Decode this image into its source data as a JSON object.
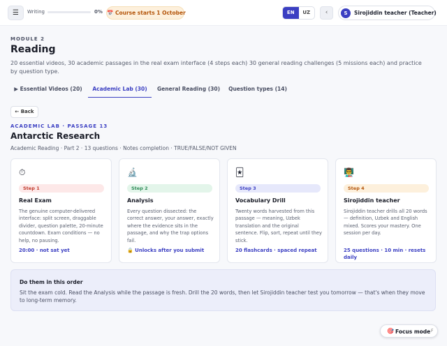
{
  "topbar": {
    "menu_icon": "menu-icon",
    "menu_glyph": "☰",
    "writing_label": "Writing",
    "progress_pct": "0%",
    "progress_fraction": 0,
    "course_notice": "📅 Course starts 1 October",
    "languages": [
      {
        "code": "EN",
        "active": true
      },
      {
        "code": "UZ",
        "active": false
      }
    ],
    "collapse_glyph": "‹",
    "user": {
      "initial": "S",
      "name": "Sirojiddin teacher (Teacher)"
    }
  },
  "module": {
    "label": "MODULE 2",
    "title": "Reading",
    "description": "20 essential videos, 30 academic passages in the real exam interface (4 steps each) 30 general reading challenges (5 missions each) and practice by question type."
  },
  "tabs": [
    {
      "label": "▶ Essential Videos (20)",
      "active": false
    },
    {
      "label": "Academic Lab (30)",
      "active": true
    },
    {
      "label": "General Reading (30)",
      "active": false
    },
    {
      "label": "Question types (14)",
      "active": false
    }
  ],
  "back_label": "← Back",
  "passage": {
    "label": "ACADEMIC LAB · PASSAGE 13",
    "title": "Antarctic Research",
    "meta": "Academic Reading · Part 2 · 13 questions · Notes completion · TRUE/FALSE/NOT GIVEN"
  },
  "cards": [
    {
      "icon": "stopwatch-icon",
      "glyph": "⏱",
      "step": "Step 1",
      "step_color": "#c0392b",
      "step_bg": "#fde8e8",
      "title": "Real Exam",
      "body": "The genuine computer-delivered interface: split screen, draggable divider, question palette, 20-minute countdown. Exam conditions — no help, no pausing.",
      "footer": "20:00 · not sat yet"
    },
    {
      "icon": "microscope-icon",
      "glyph": "🔬",
      "step": "Step 2",
      "step_color": "#2e8b57",
      "step_bg": "#e3f5ea",
      "title": "Analysis",
      "body": "Every question dissected: the correct answer, your answer, exactly where the evidence sits in the passage, and why the trap options fail.",
      "footer": "🔒 Unlocks after you submit"
    },
    {
      "icon": "flashcard-icon",
      "glyph": "🃏",
      "step": "Step 3",
      "step_color": "#3b3fc2",
      "step_bg": "#e6e8fb",
      "title": "Vocabulary Drill",
      "body": "Twenty words harvested from this passage — meaning, Uzbek translation and the original sentence. Flip, sort, repeat until they stick.",
      "footer": "20 flashcards · spaced repeat"
    },
    {
      "icon": "teacher-icon",
      "glyph": "👨‍🏫",
      "step": "Step 4",
      "step_color": "#b4560c",
      "step_bg": "#fdf0dc",
      "title": "Sirojiddin teacher",
      "body": "Sirojiddin teacher drills all 20 words — definition, Uzbek and English mixed. Scores your mastery. One session per day.",
      "footer": "25 questions · 10 min · resets daily"
    }
  ],
  "order": {
    "title": "Do them in this order",
    "body": "Sit the exam cold. Read the Analysis while the passage is fresh. Drill the 20 words, then let Sirojiddin teacher test you tomorrow — that's when they move to long-term memory."
  },
  "focus": {
    "icon": "target-icon",
    "glyph": "🎯",
    "label": "Focus mode",
    "shortcut": "F"
  }
}
